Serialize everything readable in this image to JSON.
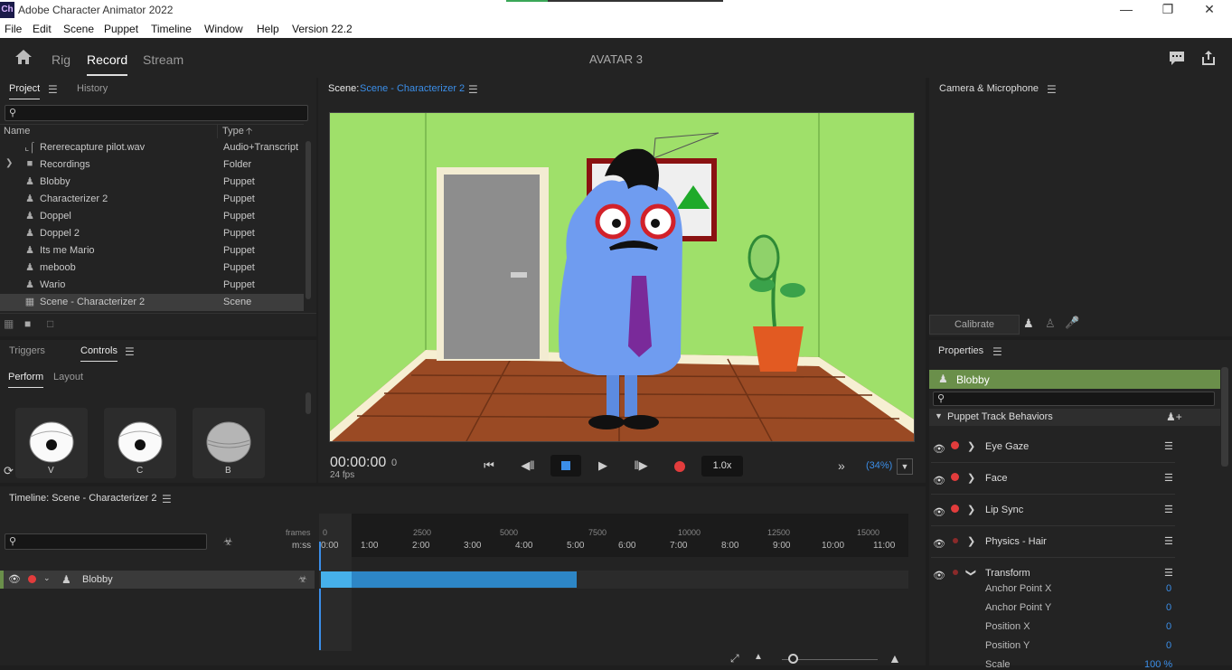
{
  "window": {
    "app_icon": "Ch",
    "title": "Adobe Character Animator 2022"
  },
  "menu": [
    "File",
    "Edit",
    "Scene",
    "Puppet",
    "Timeline",
    "Window",
    "Help",
    "Version 22.2"
  ],
  "nav": {
    "home_icon": "home-icon",
    "tabs": [
      "Rig",
      "Record",
      "Stream"
    ],
    "active": "Record",
    "document_title": "AVATAR 3"
  },
  "project": {
    "tabs": [
      "Project",
      "History"
    ],
    "columns": {
      "name": "Name",
      "type": "Type"
    },
    "items": [
      {
        "name": "Rererecapture pilot.wav",
        "type": "Audio+Transcript",
        "icon": "audio-icon"
      },
      {
        "name": "Recordings",
        "type": "Folder",
        "icon": "folder-icon"
      },
      {
        "name": "Blobby",
        "type": "Puppet",
        "icon": "puppet-icon"
      },
      {
        "name": "Characterizer 2",
        "type": "Puppet",
        "icon": "puppet-icon"
      },
      {
        "name": "Doppel",
        "type": "Puppet",
        "icon": "puppet-icon"
      },
      {
        "name": "Doppel 2",
        "type": "Puppet",
        "icon": "puppet-icon"
      },
      {
        "name": "Its me Mario",
        "type": "Puppet",
        "icon": "puppet-icon"
      },
      {
        "name": "meboob",
        "type": "Puppet",
        "icon": "puppet-icon"
      },
      {
        "name": "Wario",
        "type": "Puppet",
        "icon": "puppet-icon"
      },
      {
        "name": "Scene - Characterizer 2",
        "type": "Scene",
        "icon": "scene-icon"
      }
    ]
  },
  "controls": {
    "tabs": [
      "Triggers",
      "Controls"
    ],
    "subtabs": [
      "Perform",
      "Layout"
    ],
    "buttons": [
      {
        "key": "V"
      },
      {
        "key": "C"
      },
      {
        "key": "B"
      }
    ]
  },
  "scene": {
    "label": "Scene:",
    "name": "Scene - Characterizer 2",
    "timecode": "00:00:00",
    "frame": "0",
    "fps": "24 fps",
    "speed": "1.0x",
    "zoom": "(34%)"
  },
  "camera": {
    "title": "Camera & Microphone",
    "calibrate": "Calibrate"
  },
  "properties": {
    "title": "Properties",
    "puppet": "Blobby",
    "section": "Puppet Track Behaviors",
    "behaviors": [
      "Eye Gaze",
      "Face",
      "Lip Sync",
      "Physics - Hair",
      "Transform"
    ],
    "params": [
      {
        "label": "Anchor Point X",
        "value": "0"
      },
      {
        "label": "Anchor Point Y",
        "value": "0"
      },
      {
        "label": "Position X",
        "value": "0"
      },
      {
        "label": "Position Y",
        "value": "0"
      },
      {
        "label": "Scale",
        "value": "100 %"
      }
    ]
  },
  "timeline": {
    "title": "Timeline: Scene - Characterizer 2",
    "frames_label": "frames",
    "mss_label": "m:ss",
    "frame_ticks": [
      "0",
      "2500",
      "5000",
      "7500",
      "10000",
      "12500",
      "15000"
    ],
    "time_ticks": [
      "0:00",
      "1:00",
      "2:00",
      "3:00",
      "4:00",
      "5:00",
      "6:00",
      "7:00",
      "8:00",
      "9:00",
      "10:00",
      "11:00"
    ],
    "track": "Blobby"
  },
  "colors": {
    "accent": "#3b8ee8",
    "record": "#e23c3c",
    "puppet_header": "#6a8f4a",
    "track_bar": "#2d86c6"
  }
}
